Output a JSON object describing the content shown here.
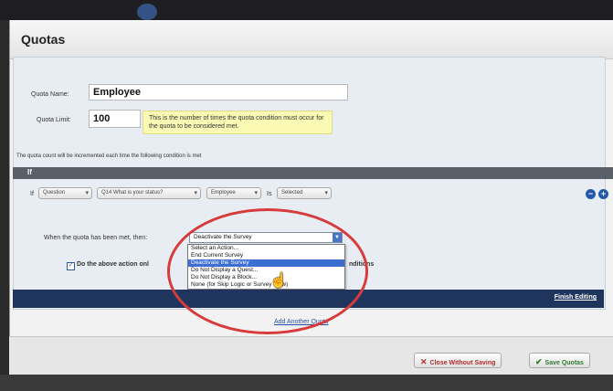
{
  "dialog": {
    "title": "Quotas"
  },
  "quota": {
    "name_label": "Quota Name:",
    "name_value": "Employee",
    "limit_label": "Quota Limit:",
    "limit_value": "100",
    "limit_hint": "This is the number of times the quota condition must occur for the quota to be considered met."
  },
  "count_line": "The quota count will be incremented each time the following condition is met",
  "if_bar_label": "If",
  "condition": {
    "if_label": "If",
    "field1": "Question",
    "field2": "Q14 What is your status?",
    "field3": "Employee",
    "is_label": "Is",
    "field4": "Selected"
  },
  "action": {
    "label": "When the quota has been met, then:",
    "selected": "Deactivate the Survey",
    "options": [
      "Select an Action...",
      "End Current Survey",
      "Deactivate the Survey",
      "Do Not Display a Quest...",
      "Do Not Display a Block...",
      "None (for Skip Logic or Survey Flow)"
    ],
    "highlighted_index": 2
  },
  "checkbox": {
    "label": "Do the above action onl",
    "label_tail": "nditions",
    "checked": true
  },
  "finish_editing": "Finish Editing",
  "add_quota": "Add Another Quota",
  "footer": {
    "close_label": "Close Without Saving",
    "save_label": "Save Quotas"
  },
  "colors": {
    "nav": "#1f355e",
    "highlight": "#3b6fd1",
    "annotation": "#d83b3b"
  },
  "icons": {
    "remove": "minus-circle-icon",
    "add": "plus-circle-icon",
    "close": "x-icon",
    "save": "check-icon"
  }
}
